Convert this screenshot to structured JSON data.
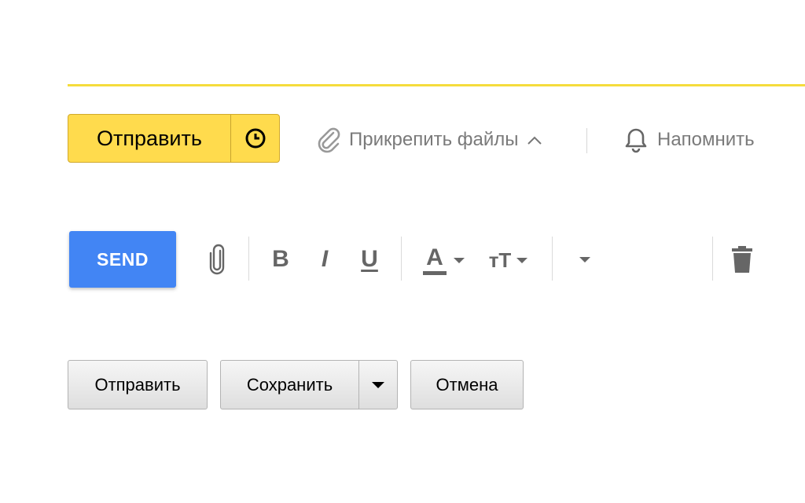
{
  "yandex": {
    "send_label": "Отправить",
    "attach_label": "Прикрепить файлы",
    "remind_label": "Напомнить",
    "icons": [
      "clock-icon",
      "paperclip-icon",
      "chevron-up-icon",
      "bell-icon"
    ],
    "accent": "#ffdb4d",
    "line_color": "#f5dc3c"
  },
  "gmail": {
    "send_label": "SEND",
    "accent": "#4285f4",
    "bold_label": "B",
    "italic_label": "I",
    "underline_label": "U",
    "text_color_label": "A",
    "font_size_label": "тT",
    "icons": [
      "paperclip-icon",
      "caret-down-icon",
      "trash-icon"
    ]
  },
  "classic": {
    "send_label": "Отправить",
    "save_label": "Сохранить",
    "cancel_label": "Отмена",
    "icons": [
      "caret-down-icon"
    ]
  }
}
